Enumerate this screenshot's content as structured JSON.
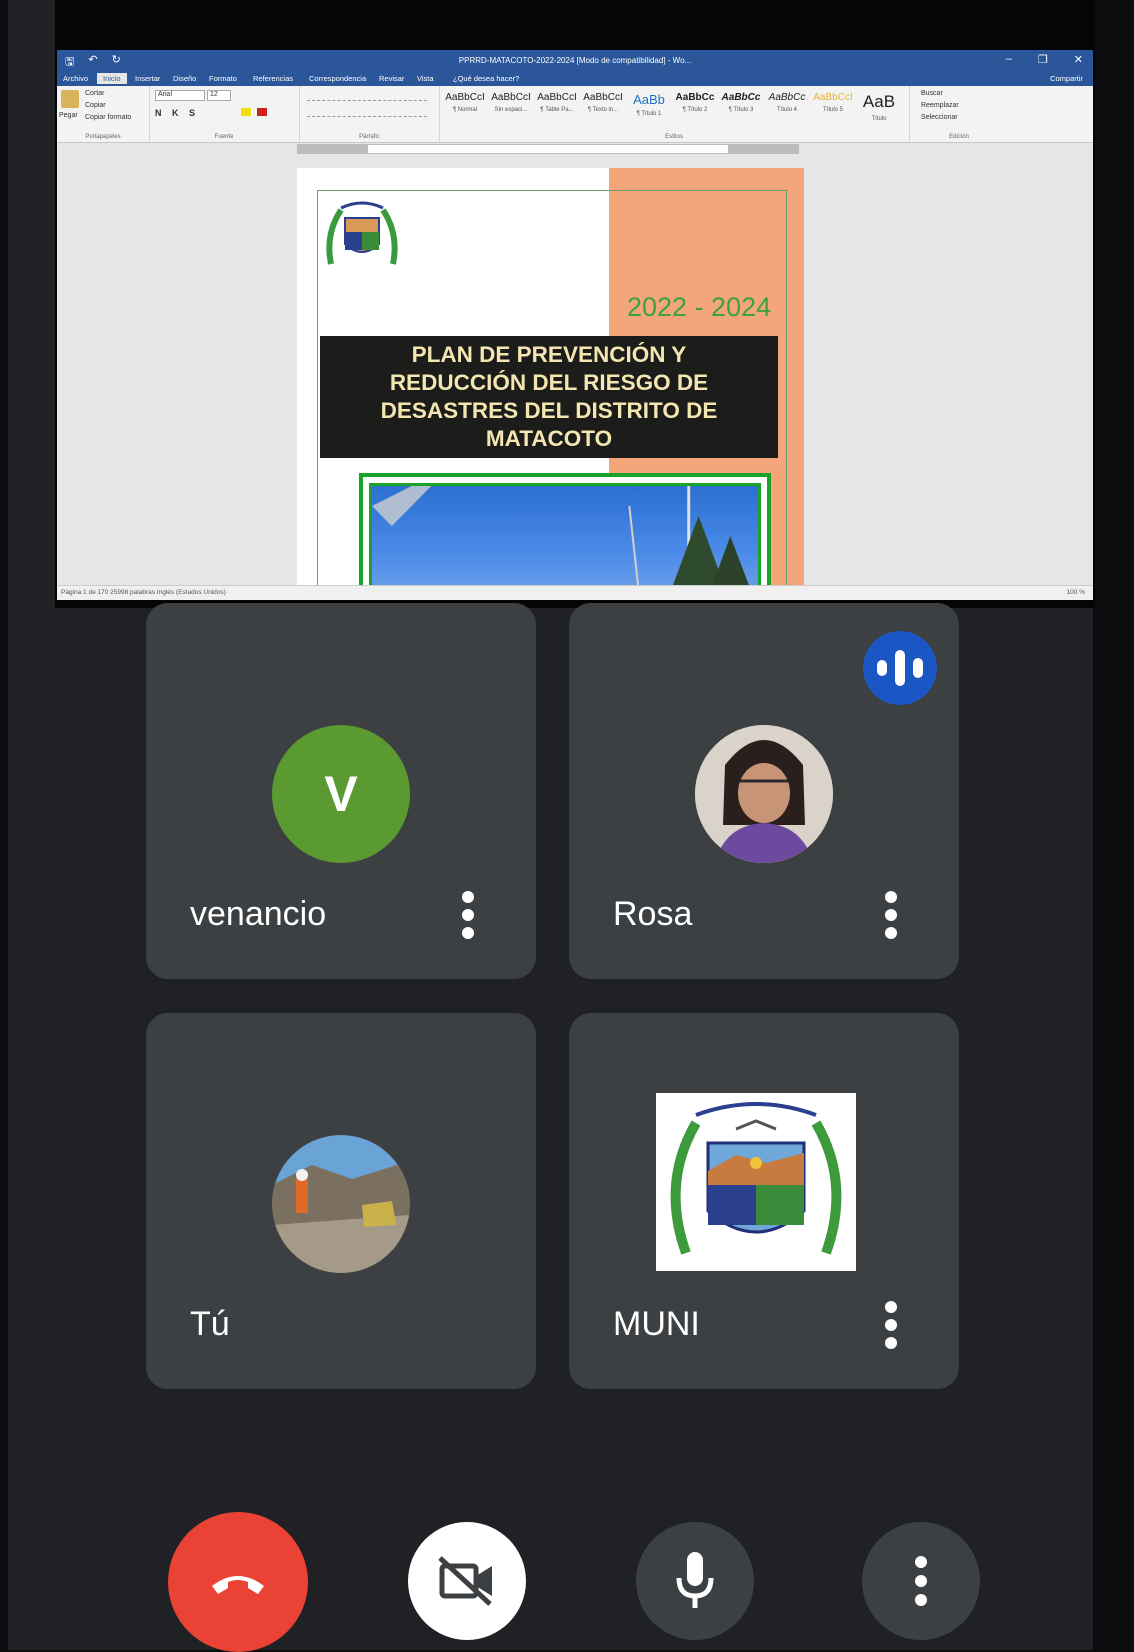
{
  "word": {
    "title": "PPRRD-MATACOTO-2022-2024 [Modo de compatibilidad] - Wo...",
    "tabs": [
      "Archivo",
      "Inicio",
      "Insertar",
      "Diseño",
      "Formato",
      "Referencias",
      "Correspondencia",
      "Revisar",
      "Vista"
    ],
    "tell_me": "¿Qué desea hacer?",
    "share": "Compartir",
    "clipboard": {
      "paste": "Pegar",
      "cut": "Cortar",
      "copy": "Copiar",
      "format": "Copiar formato",
      "group": "Portapapeles"
    },
    "font": {
      "name": "Arial",
      "size": "12",
      "group": "Fuente"
    },
    "paragraph_group": "Párrafo",
    "styles": [
      {
        "sample": "AaBbCcI",
        "name": "¶ Normal"
      },
      {
        "sample": "AaBbCcI",
        "name": "Sin espaci..."
      },
      {
        "sample": "AaBbCcI",
        "name": "¶ Table Pa..."
      },
      {
        "sample": "AaBbCcI",
        "name": "¶ Texto in..."
      },
      {
        "sample": "AaBb",
        "name": "¶ Título 1"
      },
      {
        "sample": "AaBbCc",
        "name": "¶ Título 2"
      },
      {
        "sample": "AaBbCc",
        "name": "¶ Título 3"
      },
      {
        "sample": "AaBbCc",
        "name": "Título 4"
      },
      {
        "sample": "AaBbCcI",
        "name": "Título 5"
      },
      {
        "sample": "AaB",
        "name": "Título"
      }
    ],
    "styles_group": "Estilos",
    "editing": {
      "find": "Buscar",
      "replace": "Reemplazar",
      "select": "Seleccionar",
      "group": "Edición"
    },
    "status_left": "Página 1 de 170    25998 palabras    Inglés (Estados Unidos)",
    "status_right": "100 %"
  },
  "document": {
    "year": "2022 - 2024",
    "title_lines": [
      "PLAN DE PREVENCIÓN Y",
      "REDUCCIÓN DEL RIESGO DE",
      "DESASTRES DEL DISTRITO DE",
      "MATACOTO"
    ]
  },
  "participants": [
    {
      "name": "venancio",
      "initial": "V",
      "avatar_color": "#5b9a30"
    },
    {
      "name": "Rosa",
      "speaking": true
    },
    {
      "name": "Tú"
    },
    {
      "name": "MUNI"
    }
  ],
  "controls": [
    {
      "icon": "end-call-icon",
      "color": "#ea4335"
    },
    {
      "icon": "camera-off-icon",
      "color": "#ffffff"
    },
    {
      "icon": "mic-icon",
      "color": "#3c4043"
    },
    {
      "icon": "more-options-icon",
      "color": "#3c4043"
    }
  ]
}
